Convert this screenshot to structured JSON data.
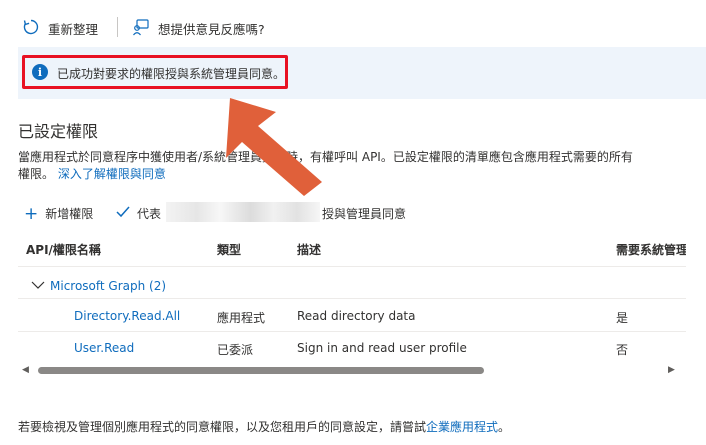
{
  "toolbar": {
    "refresh_label": "重新整理",
    "feedback_label": "想提供意見反應嗎?"
  },
  "banner": {
    "message": "已成功對要求的權限授與系統管理員同意。"
  },
  "section": {
    "title": "已設定權限",
    "description_line1": "當應用程式於同意程序中獲使用者/系統管理員授權時，有權呼叫 API。已設定權限的清單應包含應用程式需要的所有",
    "description_line2_prefix": "權限。",
    "learn_more_link": "深入了解權限與同意"
  },
  "commands": {
    "add_permission": "新增權限",
    "grant_prefix": "代表",
    "grant_suffix": "授與管理員同意"
  },
  "table": {
    "headers": [
      "API/權限名稱",
      "類型",
      "描述",
      "需要系統管理"
    ],
    "group": {
      "label": "Microsoft Graph (2)"
    },
    "rows": [
      {
        "name": "Directory.Read.All",
        "type": "應用程式",
        "description": "Read directory data",
        "admin": "是"
      },
      {
        "name": "User.Read",
        "type": "已委派",
        "description": "Sign in and read user profile",
        "admin": "否"
      }
    ]
  },
  "footer": {
    "text": "若要檢視及管理個別應用程式的同意權限，以及您租用戶的同意設定，請嘗試",
    "link": "企業應用程式",
    "suffix": "。"
  },
  "colors": {
    "accent": "#0f6cbd",
    "highlight_border": "#e81123",
    "arrow": "#e0603a",
    "banner_bg": "#eef4fb"
  }
}
